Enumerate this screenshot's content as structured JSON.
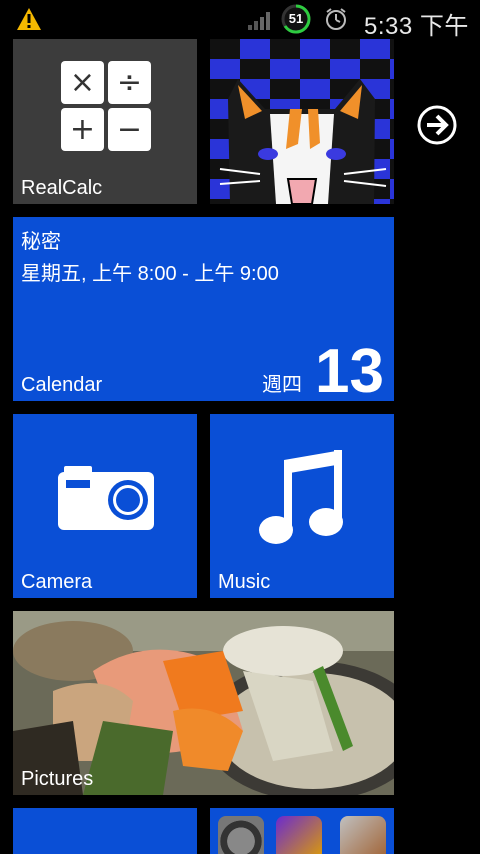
{
  "status_bar": {
    "battery_level": "51",
    "time": "5:33 下午"
  },
  "tiles": {
    "realcalc": {
      "label": "RealCalc",
      "keys": [
        "×",
        "÷",
        "+",
        "−"
      ]
    },
    "calendar": {
      "label": "Calendar",
      "event_title": "秘密",
      "event_time": "星期五, 上午 8:00 - 上午 9:00",
      "weekday": "週四",
      "day": "13"
    },
    "camera": {
      "label": "Camera"
    },
    "music": {
      "label": "Music"
    },
    "pictures": {
      "label": "Pictures"
    }
  },
  "colors": {
    "tile_blue": "#0a4fd6",
    "tile_gray": "#3c3c3c",
    "warning": "#f5b800",
    "battery_ring": "#2ecc40"
  },
  "icons": [
    "warning-icon",
    "signal-icon",
    "battery-icon",
    "alarm-icon",
    "calculator-icon",
    "arrow-right-icon",
    "camera-icon",
    "music-note-icon"
  ]
}
